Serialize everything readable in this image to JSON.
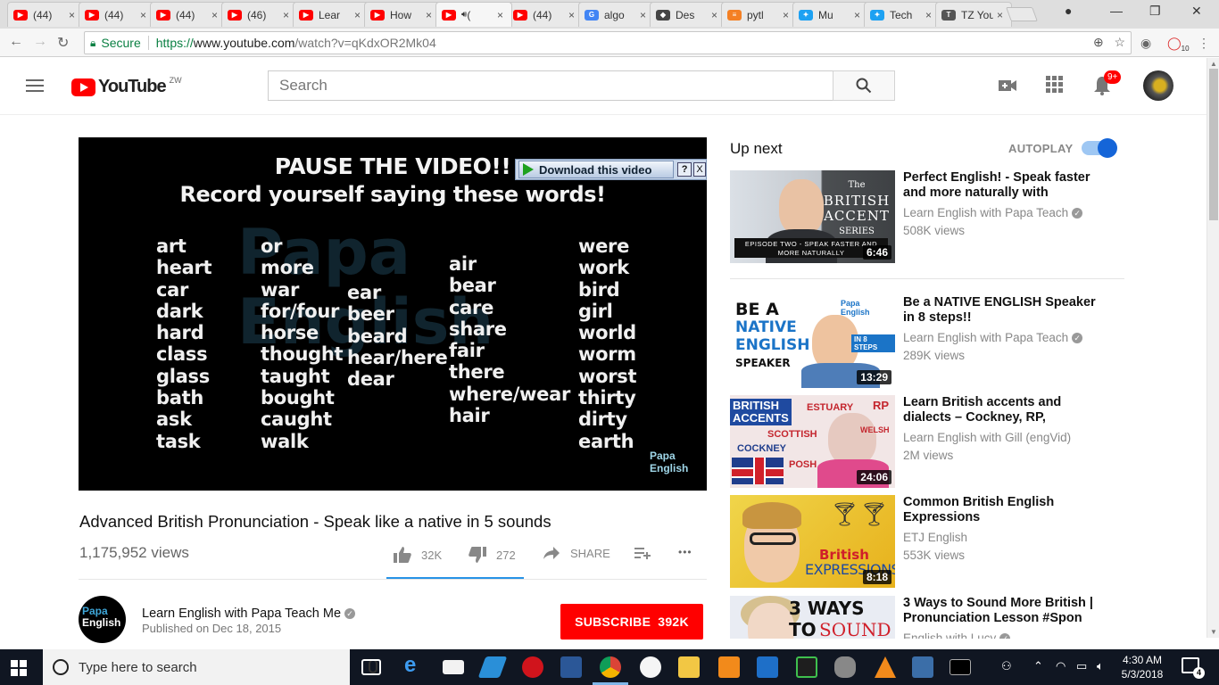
{
  "browser": {
    "tabs": [
      {
        "title": "(44)",
        "favicon": "youtube-icon",
        "active": false
      },
      {
        "title": "(44)",
        "favicon": "youtube-icon",
        "active": false
      },
      {
        "title": "(44)",
        "favicon": "youtube-icon",
        "active": false
      },
      {
        "title": "(46)",
        "favicon": "youtube-icon",
        "active": false
      },
      {
        "title": "Lear",
        "favicon": "youtube-icon",
        "active": false
      },
      {
        "title": "How",
        "favicon": "youtube-icon",
        "active": false
      },
      {
        "title": "(",
        "favicon": "youtube-icon",
        "active": true,
        "audio": "speaker-icon"
      },
      {
        "title": "(44)",
        "favicon": "youtube-icon",
        "active": false
      },
      {
        "title": "algo",
        "favicon": "google-icon",
        "active": false
      },
      {
        "title": "Des",
        "favicon": "diamond-icon",
        "active": false
      },
      {
        "title": "pytl",
        "favicon": "stackoverflow-icon",
        "active": false
      },
      {
        "title": "Mu",
        "favicon": "twitter-icon",
        "active": false
      },
      {
        "title": "Tech",
        "favicon": "twitter-icon",
        "active": false
      },
      {
        "title": "TZ You",
        "favicon": "tz-icon",
        "active": false
      }
    ],
    "close_glyph": "×",
    "address": {
      "secure_label": "Secure",
      "url_scheme": "https://",
      "url_host": "www.youtube.com",
      "url_path": "/watch?v=qKdxOR2Mk04"
    },
    "extension_badge": "10"
  },
  "youtube": {
    "logo_text": "YouTube",
    "country_code": "ZW",
    "search_placeholder": "Search",
    "notification_count": "9+"
  },
  "player": {
    "heading_line1": "PAUSE THE VIDEO!!",
    "heading_line2": "Record yourself saying these words!",
    "watermark_lines": [
      "Papa",
      "English"
    ],
    "word_columns": [
      [
        "art",
        "heart",
        "car",
        "dark",
        "hard",
        "class",
        "glass",
        "bath",
        "ask",
        "task"
      ],
      [
        "or",
        "more",
        "war",
        "for/four",
        "horse",
        "thought",
        "taught",
        "bought",
        "caught",
        "walk"
      ],
      [
        "ear",
        "beer",
        "beard",
        "hear/here",
        "dear"
      ],
      [
        "air",
        "bear",
        "care",
        "share",
        "fair",
        "there",
        "where/wear",
        "hair"
      ],
      [
        "were",
        "work",
        "bird",
        "girl",
        "world",
        "worm",
        "worst",
        "thirty",
        "dirty",
        "earth"
      ]
    ],
    "download_label": "Download this video",
    "download_help": "?",
    "download_close": "X",
    "corner_logo_line1": "Papa",
    "corner_logo_line2": "English"
  },
  "video": {
    "title": "Advanced British Pronunciation - Speak like a native in 5 sounds",
    "views": "1,175,952 views",
    "likes": "32K",
    "dislikes": "272",
    "share_label": "SHARE",
    "more_glyph": "•••"
  },
  "channel": {
    "name": "Learn English with Papa Teach Me",
    "published": "Published on Dec 18, 2015",
    "subscribe_label": "SUBSCRIBE",
    "subscriber_count": "392K",
    "avatar_line1": "Papa",
    "avatar_line2": "English"
  },
  "sidebar": {
    "up_next_label": "Up next",
    "autoplay_label": "AUTOPLAY",
    "autoplay_on": true,
    "recommendations": [
      {
        "title": "Perfect English! - Speak faster and more naturally with",
        "channel": "Learn English with Papa Teach",
        "verified": true,
        "views": "508K views",
        "duration": "6:46",
        "thumb_text": {
          "small": "The",
          "big1": "BRITISH",
          "big2": "ACCENT",
          "small2": "SERIES",
          "band": "EPISODE TWO - SPEAK FASTER AND MORE NATURALLY"
        }
      },
      {
        "title": "Be a NATIVE ENGLISH Speaker in 8 steps!!",
        "channel": "Learn English with Papa Teach",
        "verified": true,
        "views": "289K views",
        "duration": "13:29",
        "thumb_text": {
          "l1": "BE A",
          "l2": "NATIVE",
          "l3": "ENGLISH",
          "l4": "SPEAKER",
          "step": "IN 8 STEPS",
          "logo1": "Papa",
          "logo2": "English"
        }
      },
      {
        "title": "Learn British accents and dialects – Cockney, RP,",
        "channel": "Learn English with Gill (engVid)",
        "verified": false,
        "views": "2M views",
        "duration": "24:06",
        "thumb_text": {
          "h1": "BRITISH",
          "h2": "ACCENTS",
          "estuary": "ESTUARY",
          "rp": "RP",
          "scottish": "SCOTTISH",
          "welsh": "WELSH",
          "cockney": "COCKNEY",
          "posh": "POSH"
        }
      },
      {
        "title": "Common British English Expressions",
        "channel": "ETJ English",
        "verified": false,
        "views": "553K views",
        "duration": "8:18",
        "thumb_text": {
          "w1": "British",
          "w2": "EXPRESSIONS"
        }
      },
      {
        "title": "3 Ways to Sound More British | Pronunciation Lesson #Spon",
        "channel": "English with Lucy",
        "verified": true,
        "views": "",
        "duration": "",
        "thumb_text": {
          "w1": "3 WAYS TO",
          "w2": "SOUND"
        }
      }
    ]
  },
  "taskbar": {
    "search_placeholder": "Type here to search",
    "time": "4:30 AM",
    "date": "5/3/2018",
    "notification_count": "4"
  }
}
